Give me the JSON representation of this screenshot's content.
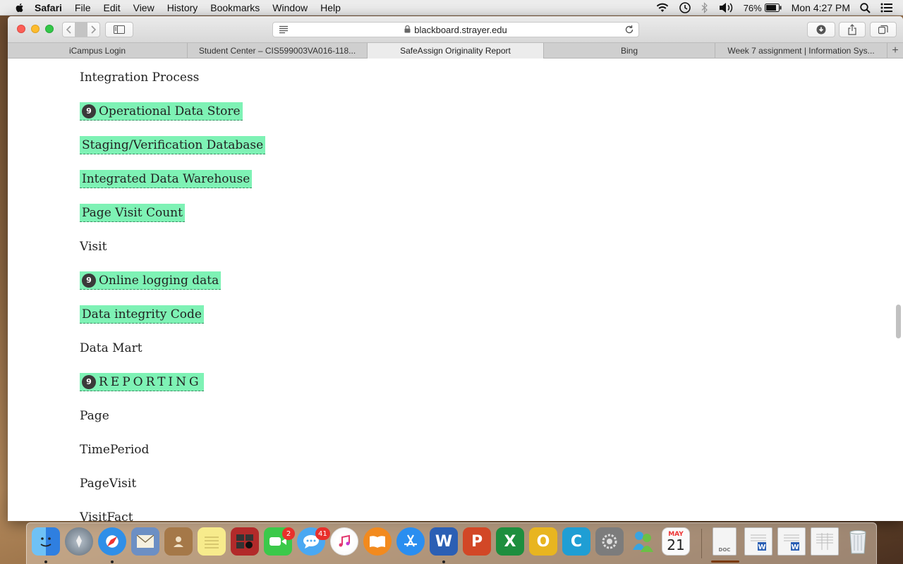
{
  "menubar": {
    "app_name": "Safari",
    "menus": [
      "File",
      "Edit",
      "View",
      "History",
      "Bookmarks",
      "Window",
      "Help"
    ],
    "battery": "76%",
    "clock": "Mon 4:27 PM"
  },
  "browser": {
    "url": "blackboard.strayer.edu",
    "tabs": [
      {
        "label": "iCampus Login",
        "active": false
      },
      {
        "label": "Student Center – CIS599003VA016-118...",
        "active": false
      },
      {
        "label": "SafeAssign Originality Report",
        "active": true
      },
      {
        "label": "Bing",
        "active": false
      },
      {
        "label": "Week 7 assignment | Information Sys...",
        "active": false
      }
    ],
    "new_tab": "+"
  },
  "report": {
    "highlight_color": "#7ef2b5",
    "lines": [
      {
        "text": "Integration Process",
        "highlighted": false,
        "badge": ""
      },
      {
        "text": "Operational Data Store",
        "highlighted": true,
        "badge": "9"
      },
      {
        "text": "Staging/Verification Database",
        "highlighted": true,
        "badge": ""
      },
      {
        "text": "Integrated Data Warehouse",
        "highlighted": true,
        "badge": ""
      },
      {
        "text": "Page Visit Count",
        "highlighted": true,
        "badge": ""
      },
      {
        "text": "Visit",
        "highlighted": false,
        "badge": ""
      },
      {
        "text": "Online logging data",
        "highlighted": true,
        "badge": "9"
      },
      {
        "text": "Data integrity Code",
        "highlighted": true,
        "badge": ""
      },
      {
        "text": "Data Mart",
        "highlighted": false,
        "badge": ""
      },
      {
        "text": "REPORTING",
        "highlighted": true,
        "badge": "9"
      },
      {
        "text": "Page",
        "highlighted": false,
        "badge": ""
      },
      {
        "text": "TimePeriod",
        "highlighted": false,
        "badge": ""
      },
      {
        "text": "PageVisit",
        "highlighted": false,
        "badge": ""
      },
      {
        "text": "VisitFact",
        "highlighted": false,
        "badge": ""
      }
    ]
  },
  "dock": {
    "apps": [
      {
        "icon": "finder-icon",
        "color": "#3a8ee6",
        "running": true
      },
      {
        "icon": "launchpad-icon",
        "color": "#7b8a9a",
        "running": false
      },
      {
        "icon": "safari-icon",
        "color": "#2f8fe8",
        "running": true
      },
      {
        "icon": "mail-icon",
        "color": "#5a7fb5",
        "running": false
      },
      {
        "icon": "contacts-icon",
        "color": "#a57848",
        "running": false
      },
      {
        "icon": "notes-icon",
        "color": "#f4e27a",
        "running": false
      },
      {
        "icon": "photo-booth-icon",
        "color": "#b22a2a",
        "running": false
      },
      {
        "icon": "facetime-icon",
        "color": "#3bc94a",
        "running": false,
        "badge": "2"
      },
      {
        "icon": "messages-icon",
        "color": "#4aa8f2",
        "running": false,
        "badge": "41"
      },
      {
        "icon": "itunes-icon",
        "color": "#f2f2f2",
        "running": false
      },
      {
        "icon": "ibooks-icon",
        "color": "#f28a1e",
        "running": false
      },
      {
        "icon": "app-store-icon",
        "color": "#2a8ef0",
        "running": false
      },
      {
        "icon": "word-icon",
        "color": "#2b5fb4",
        "running": true,
        "glyph": "W"
      },
      {
        "icon": "powerpoint-icon",
        "color": "#d24726",
        "running": false,
        "glyph": "P"
      },
      {
        "icon": "excel-icon",
        "color": "#1e8e3e",
        "running": false,
        "glyph": "X"
      },
      {
        "icon": "outlook-icon",
        "color": "#e8b520",
        "running": false,
        "glyph": "O"
      },
      {
        "icon": "c-app-icon",
        "color": "#1f9ed4",
        "running": false,
        "glyph": "C"
      },
      {
        "icon": "system-preferences-icon",
        "color": "#8a8a8a",
        "running": false
      },
      {
        "icon": "messenger-icon",
        "color": "#3aa4e0",
        "running": false
      },
      {
        "icon": "calendar-icon",
        "color": "#fafafa",
        "running": false,
        "month": "MAY",
        "day": "21"
      }
    ],
    "docs": [
      {
        "icon": "document-icon",
        "label": "DOC"
      },
      {
        "icon": "word-document-icon"
      },
      {
        "icon": "word-document-icon"
      },
      {
        "icon": "spreadsheet-document-icon"
      },
      {
        "icon": "trash-icon"
      }
    ]
  }
}
